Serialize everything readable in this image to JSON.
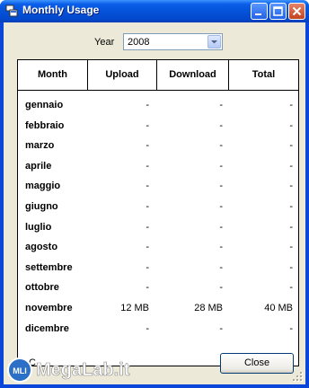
{
  "window": {
    "title": "Monthly Usage"
  },
  "year": {
    "label": "Year",
    "value": "2008"
  },
  "table": {
    "headers": [
      "Month",
      "Upload",
      "Download",
      "Total"
    ],
    "rows": [
      {
        "month": "gennaio",
        "upload": "-",
        "download": "-",
        "total": "-"
      },
      {
        "month": "febbraio",
        "upload": "-",
        "download": "-",
        "total": "-"
      },
      {
        "month": "marzo",
        "upload": "-",
        "download": "-",
        "total": "-"
      },
      {
        "month": "aprile",
        "upload": "-",
        "download": "-",
        "total": "-"
      },
      {
        "month": "maggio",
        "upload": "-",
        "download": "-",
        "total": "-"
      },
      {
        "month": "giugno",
        "upload": "-",
        "download": "-",
        "total": "-"
      },
      {
        "month": "luglio",
        "upload": "-",
        "download": "-",
        "total": "-"
      },
      {
        "month": "agosto",
        "upload": "-",
        "download": "-",
        "total": "-"
      },
      {
        "month": "settembre",
        "upload": "-",
        "download": "-",
        "total": "-"
      },
      {
        "month": "ottobre",
        "upload": "-",
        "download": "-",
        "total": "-"
      },
      {
        "month": "novembre",
        "upload": "12 MB",
        "download": "28 MB",
        "total": "40 MB"
      },
      {
        "month": "dicembre",
        "upload": "-",
        "download": "-",
        "total": "-"
      }
    ]
  },
  "buttons": {
    "close": "Close"
  },
  "status": {
    "text": "C"
  },
  "watermark": {
    "text": "MegaLab.it",
    "badge": "MLI"
  },
  "colors": {
    "titlebar": "#0552d9",
    "client": "#ece9d8",
    "accent": "#0a46d8"
  }
}
